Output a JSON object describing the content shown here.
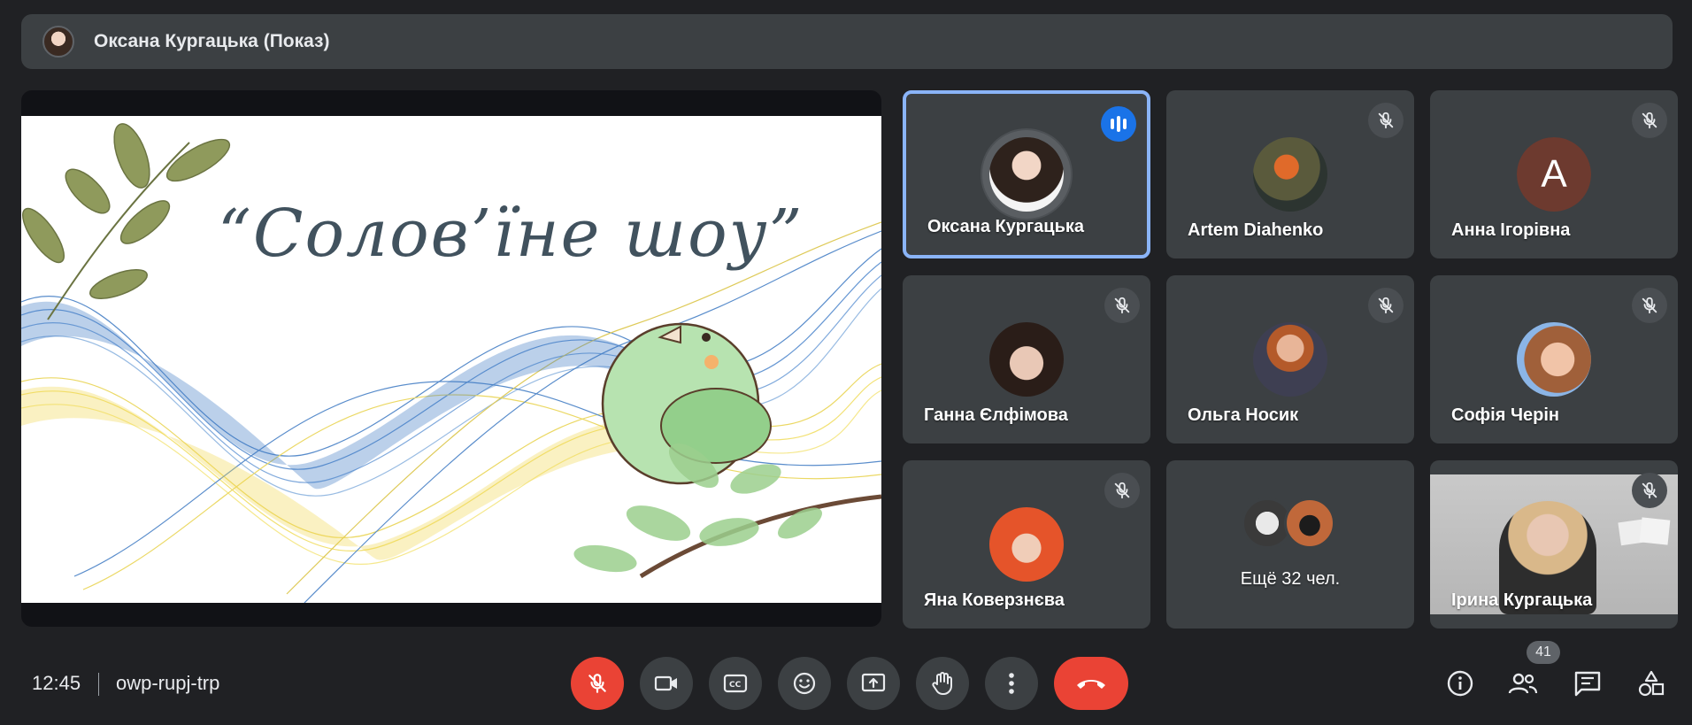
{
  "presenter": {
    "name": "Оксана Кургацька (Показ)"
  },
  "slide": {
    "title": "“Солов’їне шоу”"
  },
  "participants": [
    {
      "name": "Оксана Кургацька",
      "state": "speaking"
    },
    {
      "name": "Artem Diahenko",
      "state": "muted"
    },
    {
      "name": "Анна Ігорівна",
      "state": "muted",
      "initial": "A"
    },
    {
      "name": "Ганна Єлфімова",
      "state": "muted"
    },
    {
      "name": "Ольга Носик",
      "state": "muted"
    },
    {
      "name": "Софія Черін",
      "state": "muted"
    },
    {
      "name": "Яна Коверзнєва",
      "state": "muted"
    },
    {
      "name": "Ещё 32 чел.",
      "state": "overflow"
    },
    {
      "name": "Ірина Кургацька",
      "state": "muted"
    }
  ],
  "bottom_bar": {
    "time": "12:45",
    "meeting_code": "owp-rupj-trp",
    "people_count": "41"
  },
  "colors": {
    "background": "#202124",
    "tile": "#3c4043",
    "active_border": "#8ab4f8",
    "danger": "#ea4335",
    "speaking": "#1a73e8"
  },
  "icons": {
    "mic": "mic-off-icon",
    "camera": "videocam-icon",
    "captions": "closed-captions-icon",
    "reactions": "emoji-icon",
    "present": "present-screen-icon",
    "raise_hand": "raise-hand-icon",
    "more": "more-vert-icon",
    "hangup": "call-end-icon",
    "info": "info-icon",
    "people": "people-icon",
    "chat": "chat-icon",
    "activities": "activities-icon"
  }
}
